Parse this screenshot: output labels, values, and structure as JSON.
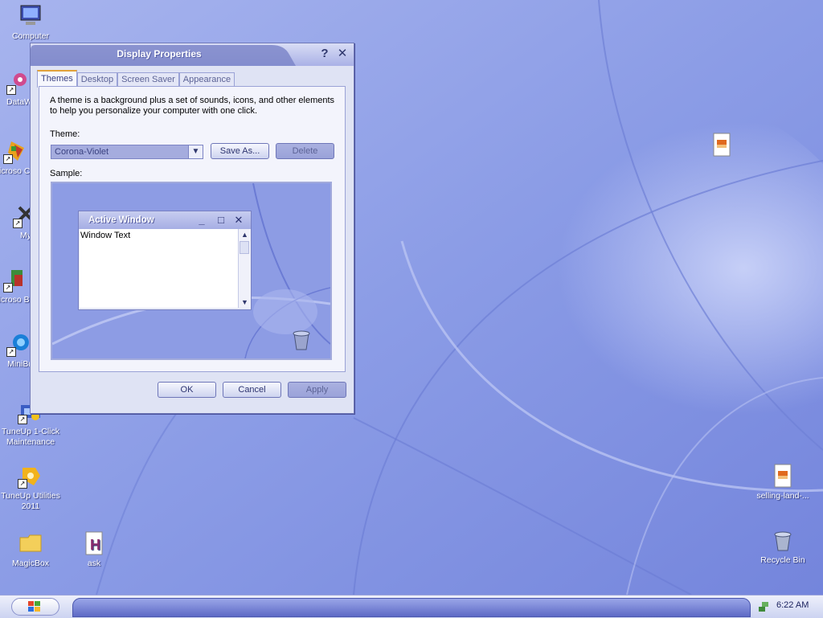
{
  "desktop": {
    "icons": [
      {
        "label": "Computer"
      },
      {
        "label": "DataW"
      },
      {
        "label": "Microso C++"
      },
      {
        "label": "My"
      },
      {
        "label": "Microso Basi"
      },
      {
        "label": "MiniBr"
      },
      {
        "label": "TuneUp 1-Click Maintenance"
      },
      {
        "label": "TuneUp Utilities 2011"
      },
      {
        "label": "MagicBox"
      },
      {
        "label": "ask"
      },
      {
        "label": "selling-land-..."
      },
      {
        "label": "Recycle Bin"
      }
    ]
  },
  "dialog": {
    "title": "Display Properties",
    "help_label": "?",
    "close_label": "✕",
    "tabs": [
      {
        "label": "Themes"
      },
      {
        "label": "Desktop"
      },
      {
        "label": "Screen Saver"
      },
      {
        "label": "Appearance"
      }
    ],
    "description_line1": "A theme is a background plus a set of sounds, icons, and other elements",
    "description_line2": "to help you personalize your computer with one click.",
    "theme_label": "Theme:",
    "theme_value": "Corona-Violet",
    "save_as_label": "Save As...",
    "delete_label": "Delete",
    "sample_label": "Sample:",
    "sample_window_title": "Active Window",
    "sample_window_text": "Window Text",
    "ok_label": "OK",
    "cancel_label": "Cancel",
    "apply_label": "Apply"
  },
  "taskbar": {
    "clock": "6:22 AM"
  }
}
